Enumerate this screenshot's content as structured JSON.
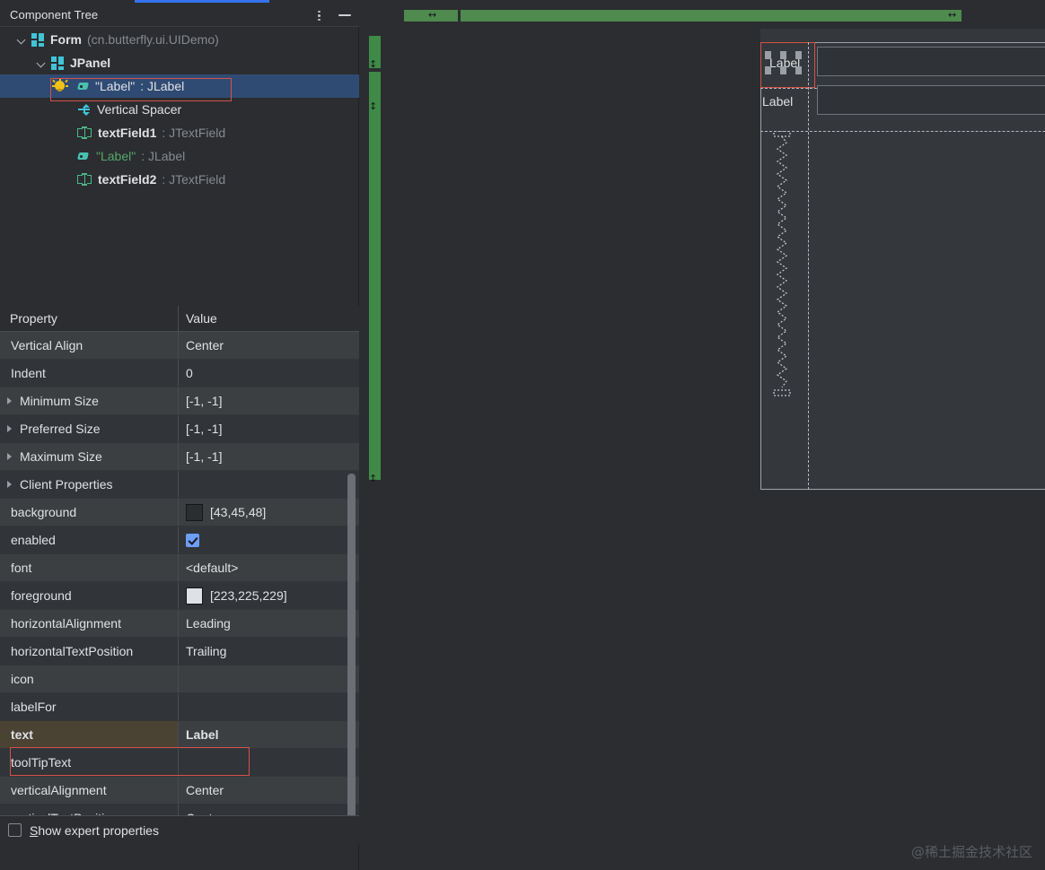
{
  "window": {
    "accent_color": "#3573f0",
    "background": "#2b2d30"
  },
  "component_tree_panel": {
    "title": "Component Tree",
    "menu_icon": "more-vertical-icon",
    "minimize_icon": "minimize-icon",
    "nodes": [
      {
        "icon": "form-grid-icon",
        "name": "Form",
        "type": "(cn.butterfly.ui.UIDemo)",
        "depth": 0,
        "expanded": true,
        "selected": false,
        "name_style": "bold",
        "type_style": "dim"
      },
      {
        "icon": "form-grid-icon",
        "name": "JPanel",
        "type": "",
        "depth": 1,
        "expanded": true,
        "selected": false,
        "name_style": "bold",
        "type_style": "dim"
      },
      {
        "icon": "tag-icon",
        "extra_icon": "lightbulb-icon",
        "name": "\"Label\"",
        "type": ": JLabel",
        "depth": 2,
        "expanded": false,
        "selected": true,
        "name_style": "plain",
        "type_style": "plain"
      },
      {
        "icon": "vertical-spacer-icon",
        "name": "Vertical Spacer",
        "type": "",
        "depth": 2,
        "expanded": false,
        "selected": false,
        "name_style": "plain",
        "type_style": "plain"
      },
      {
        "icon": "textfield-icon",
        "name": "textField1",
        "type": ": JTextField",
        "depth": 2,
        "expanded": false,
        "selected": false,
        "name_style": "bold",
        "type_style": "dim"
      },
      {
        "icon": "tag-icon",
        "name": "\"Label\"",
        "type": ": JLabel",
        "depth": 2,
        "expanded": false,
        "selected": false,
        "name_style": "green",
        "type_style": "dim"
      },
      {
        "icon": "textfield-icon",
        "name": "textField2",
        "type": ": JTextField",
        "depth": 2,
        "expanded": false,
        "selected": false,
        "name_style": "bold",
        "type_style": "dim"
      }
    ]
  },
  "property_table": {
    "columns": [
      "Property",
      "Value"
    ],
    "rows": [
      {
        "name": "Vertical Align",
        "value": "Center",
        "expandable": false,
        "kind": "text",
        "highlighted": false
      },
      {
        "name": "Indent",
        "value": "0",
        "expandable": false,
        "kind": "text",
        "highlighted": false
      },
      {
        "name": "Minimum Size",
        "value": "[-1, -1]",
        "expandable": true,
        "kind": "text",
        "highlighted": false
      },
      {
        "name": "Preferred Size",
        "value": "[-1, -1]",
        "expandable": true,
        "kind": "text",
        "highlighted": false
      },
      {
        "name": "Maximum Size",
        "value": "[-1, -1]",
        "expandable": true,
        "kind": "text",
        "highlighted": false
      },
      {
        "name": "Client Properties",
        "value": "",
        "expandable": true,
        "kind": "text",
        "highlighted": false
      },
      {
        "name": "background",
        "value": "[43,45,48]",
        "expandable": false,
        "kind": "color",
        "swatch": "#2b2d30",
        "highlighted": false
      },
      {
        "name": "enabled",
        "value": "",
        "expandable": false,
        "kind": "checkbox",
        "checked": true,
        "highlighted": false
      },
      {
        "name": "font",
        "value": "<default>",
        "expandable": false,
        "kind": "text",
        "highlighted": false
      },
      {
        "name": "foreground",
        "value": "[223,225,229]",
        "expandable": false,
        "kind": "color",
        "swatch": "#dfe1e5",
        "highlighted": false
      },
      {
        "name": "horizontalAlignment",
        "value": "Leading",
        "expandable": false,
        "kind": "text",
        "highlighted": false
      },
      {
        "name": "horizontalTextPosition",
        "value": "Trailing",
        "expandable": false,
        "kind": "text",
        "highlighted": false
      },
      {
        "name": "icon",
        "value": "",
        "expandable": false,
        "kind": "text",
        "highlighted": false
      },
      {
        "name": "labelFor",
        "value": "",
        "expandable": false,
        "kind": "text",
        "highlighted": false
      },
      {
        "name": "text",
        "value": "Label",
        "expandable": false,
        "kind": "text",
        "highlighted": true
      },
      {
        "name": "toolTipText",
        "value": "",
        "expandable": false,
        "kind": "text",
        "highlighted": false
      },
      {
        "name": "verticalAlignment",
        "value": "Center",
        "expandable": false,
        "kind": "text",
        "highlighted": false
      },
      {
        "name": "verticalTextPosition",
        "value": "Center",
        "expandable": false,
        "kind": "text",
        "highlighted": false
      }
    ],
    "footer": {
      "checkbox_checked": false,
      "mnemonic": "S",
      "label_rest": "how expert properties"
    }
  },
  "designer": {
    "column_rail_color": "#4f8a4f",
    "row_rail_color": "#3f8a47",
    "resize_handle_h": "↔",
    "resize_handle_v": "↕",
    "selection_color": "#d4524a",
    "cells": [
      {
        "label": "Label",
        "selected": true
      },
      {
        "label": "Label",
        "selected": false
      }
    ],
    "text_fields": [
      {
        "value": ""
      },
      {
        "value": ""
      }
    ],
    "spacer": "vertical-spring"
  },
  "watermark": "@稀土掘金技术社区"
}
